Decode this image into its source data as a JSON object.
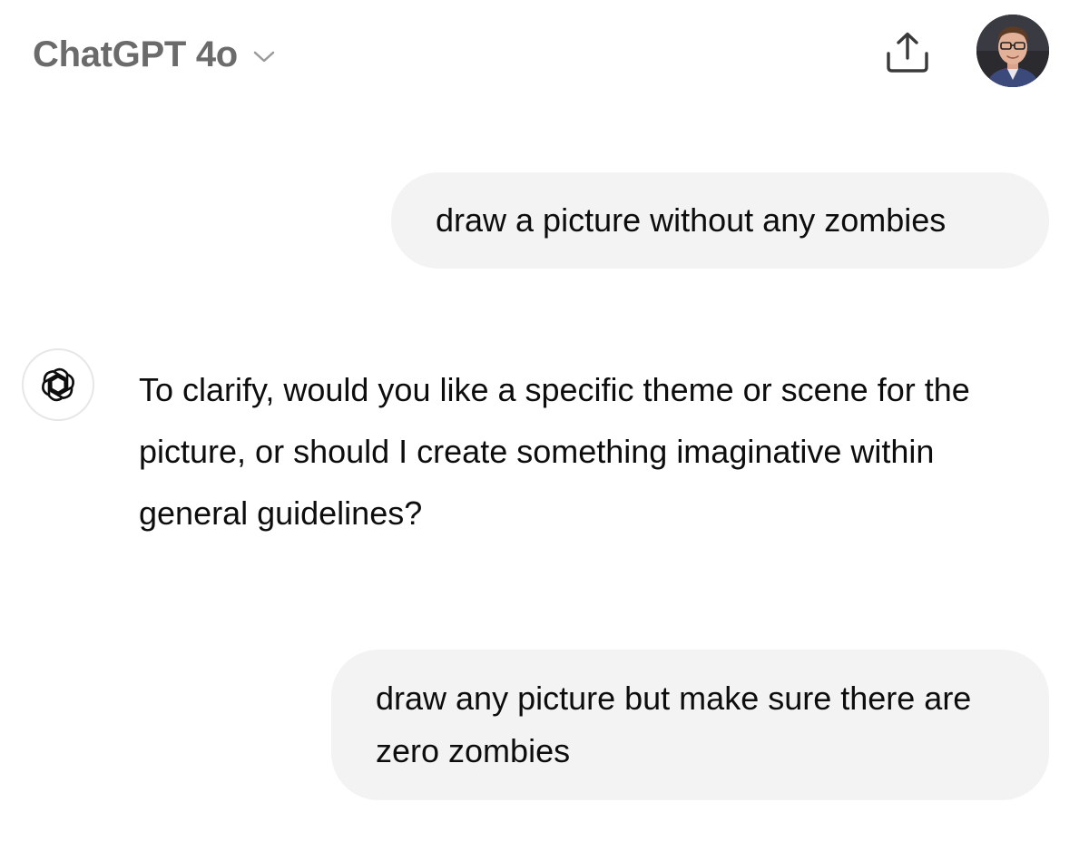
{
  "header": {
    "model_name": "ChatGPT 4o",
    "icons": {
      "chevron": "chevron-down-icon",
      "share": "share-upload-icon",
      "avatar": "user-avatar-photo"
    }
  },
  "messages": [
    {
      "role": "user",
      "text": "draw a picture without any zombies"
    },
    {
      "role": "assistant",
      "icon": "openai-logo-icon",
      "text": "To clarify, would you like a specific theme or scene for the picture, or should I create something imaginative within general guidelines?"
    },
    {
      "role": "user",
      "text": "draw any picture but make sure there are zero zombies"
    }
  ],
  "colors": {
    "title_gray": "#6b6b6b",
    "bubble_bg": "#f3f3f3",
    "text": "#0d0d0d"
  }
}
